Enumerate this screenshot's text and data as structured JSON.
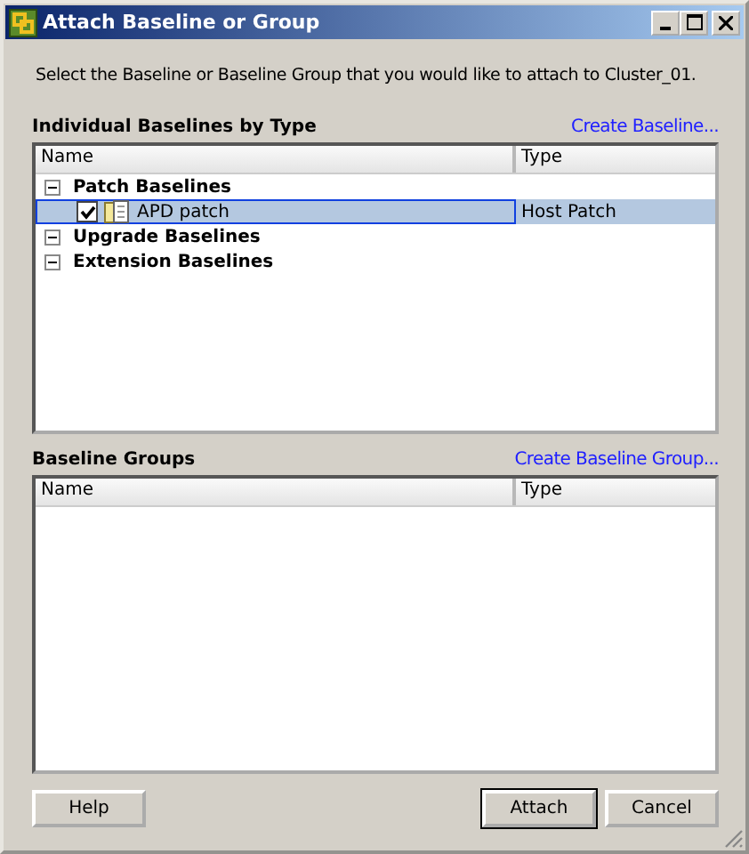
{
  "window": {
    "title": "Attach Baseline or Group"
  },
  "instruction": "Select the Baseline or Baseline Group that you would like to attach to Cluster_01.",
  "baselines": {
    "heading": "Individual Baselines by Type",
    "link": "Create Baseline...",
    "columns": [
      "Name",
      "Type"
    ],
    "groups": [
      {
        "label": "Patch Baselines",
        "expanded": true,
        "children": [
          {
            "name": "APD patch",
            "type": "Host Patch",
            "checked": true,
            "selected": true
          }
        ]
      },
      {
        "label": "Upgrade Baselines",
        "expanded": true
      },
      {
        "label": "Extension Baselines",
        "expanded": true
      }
    ]
  },
  "baseline_groups": {
    "heading": "Baseline Groups",
    "link": "Create Baseline Group...",
    "columns": [
      "Name",
      "Type"
    ]
  },
  "buttons": {
    "help": "Help",
    "attach": "Attach",
    "cancel": "Cancel"
  }
}
